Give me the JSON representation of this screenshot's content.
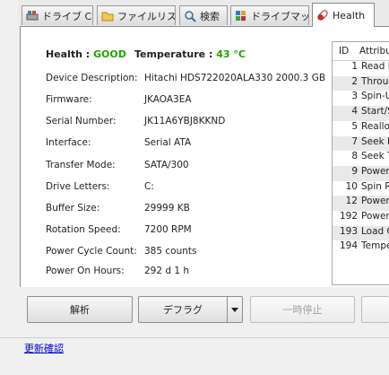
{
  "tabs": [
    {
      "label": "ドライブ C:",
      "icon": "drive-icon"
    },
    {
      "label": "ファイルリスト",
      "icon": "folder-icon"
    },
    {
      "label": "検索",
      "icon": "magnifier-icon"
    },
    {
      "label": "ドライブマップ",
      "icon": "map-icon"
    },
    {
      "label": "Health",
      "icon": "pill-icon"
    }
  ],
  "health": {
    "health_label": "Health :",
    "health_value": "GOOD",
    "temp_label": "Temperature :",
    "temp_value": "43 °C",
    "status_color": "#22a000"
  },
  "info": [
    {
      "label": "Device Description:",
      "value": "Hitachi HDS722020ALA330 2000.3 GB"
    },
    {
      "label": "Firmware:",
      "value": "JKAOA3EA"
    },
    {
      "label": "Serial Number:",
      "value": "JK11A6YBJ8KKND"
    },
    {
      "label": "Interface:",
      "value": "Serial ATA"
    },
    {
      "label": "Transfer Mode:",
      "value": "SATA/300"
    },
    {
      "label": "Drive Letters:",
      "value": "C:"
    },
    {
      "label": "Buffer Size:",
      "value": "29999 KB"
    },
    {
      "label": "Rotation Speed:",
      "value": "7200 RPM"
    },
    {
      "label": "Power Cycle Count:",
      "value": "385 counts"
    },
    {
      "label": "Power On Hours:",
      "value": "292 d 1 h"
    }
  ],
  "smart": {
    "col_id": "ID",
    "col_attr": "Attribu",
    "rows": [
      {
        "id": "1",
        "name": "Read E"
      },
      {
        "id": "2",
        "name": "Throug"
      },
      {
        "id": "3",
        "name": "Spin-Up"
      },
      {
        "id": "4",
        "name": "Start/S"
      },
      {
        "id": "5",
        "name": "Realloc"
      },
      {
        "id": "7",
        "name": "Seek Er"
      },
      {
        "id": "8",
        "name": "Seek Ti"
      },
      {
        "id": "9",
        "name": "Power-"
      },
      {
        "id": "10",
        "name": "Spin Re"
      },
      {
        "id": "12",
        "name": "Power"
      },
      {
        "id": "192",
        "name": "Power-"
      },
      {
        "id": "193",
        "name": "Load C"
      },
      {
        "id": "194",
        "name": "Temper"
      }
    ]
  },
  "buttons": {
    "analyze": "解析",
    "defrag": "デフラグ",
    "pause": "一時停止"
  },
  "update_link": "更新確認"
}
